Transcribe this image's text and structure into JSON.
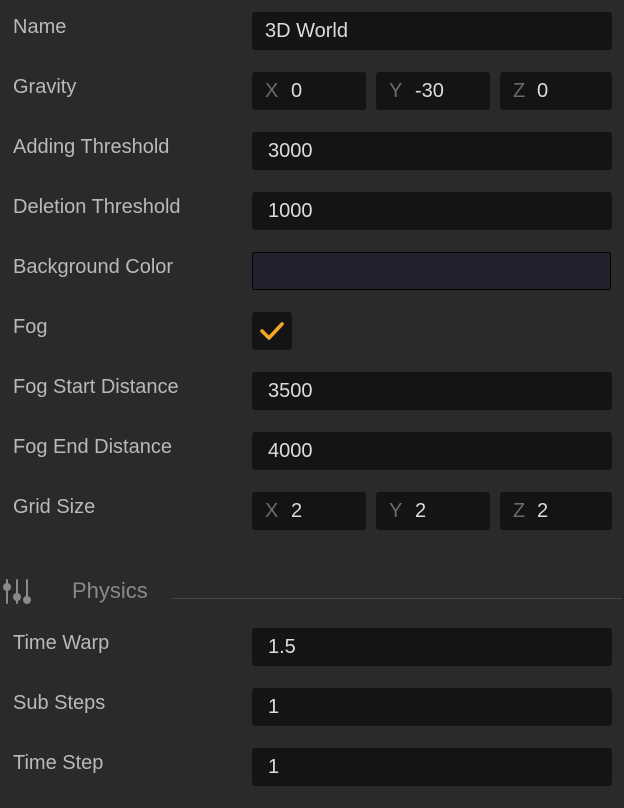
{
  "colors": {
    "panel_bg": "#2a2a2a",
    "field_bg": "#141414",
    "accent": "#f5a623",
    "background_color_value": "#21212e"
  },
  "world": {
    "name_label": "Name",
    "name_value": "3D World",
    "gravity_label": "Gravity",
    "gravity": {
      "x_axis": "X",
      "x": "0",
      "y_axis": "Y",
      "y": "-30",
      "z_axis": "Z",
      "z": "0"
    },
    "adding_threshold_label": "Adding Threshold",
    "adding_threshold_value": "3000",
    "deletion_threshold_label": "Deletion Threshold",
    "deletion_threshold_value": "1000",
    "background_color_label": "Background Color",
    "fog_label": "Fog",
    "fog_checked": true,
    "fog_start_label": "Fog Start Distance",
    "fog_start_value": "3500",
    "fog_end_label": "Fog End Distance",
    "fog_end_value": "4000",
    "grid_size_label": "Grid Size",
    "grid_size": {
      "x_axis": "X",
      "x": "2",
      "y_axis": "Y",
      "y": "2",
      "z_axis": "Z",
      "z": "2"
    }
  },
  "physics": {
    "section_title": "Physics",
    "section_icon": "sliders-icon",
    "time_warp_label": "Time Warp",
    "time_warp_value": "1.5",
    "sub_steps_label": "Sub Steps",
    "sub_steps_value": "1",
    "time_step_label": "Time Step",
    "time_step_value": "1"
  }
}
